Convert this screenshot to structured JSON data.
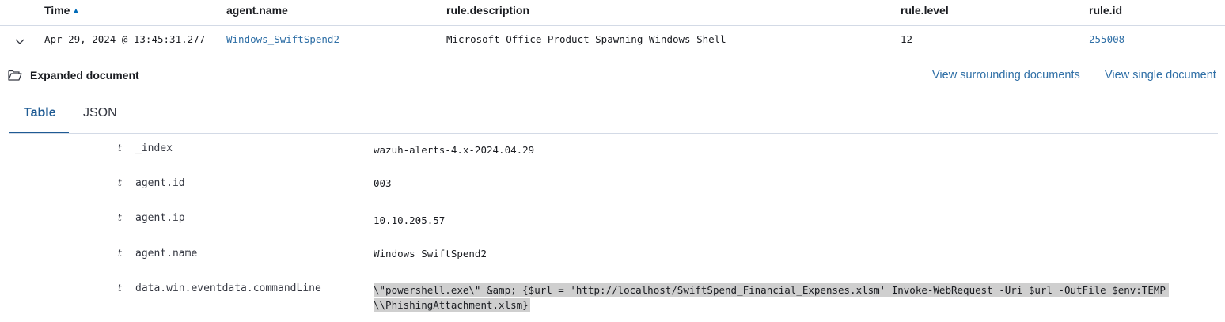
{
  "columns": {
    "time": "Time",
    "agent_name": "agent.name",
    "rule_description": "rule.description",
    "rule_level": "rule.level",
    "rule_id": "rule.id"
  },
  "row": {
    "time": "Apr 29, 2024 @ 13:45:31.277",
    "agent_name": "Windows_SwiftSpend2",
    "rule_description": "Microsoft Office Product Spawning Windows Shell",
    "rule_level": "12",
    "rule_id": "255008"
  },
  "expanded": {
    "title": "Expanded document",
    "view_surrounding": "View surrounding documents",
    "view_single": "View single document",
    "tabs": {
      "table": "Table",
      "json": "JSON"
    }
  },
  "fields": [
    {
      "type": "t",
      "name": "_index",
      "value": "wazuh-alerts-4.x-2024.04.29"
    },
    {
      "type": "t",
      "name": "agent.id",
      "value": "003"
    },
    {
      "type": "t",
      "name": "agent.ip",
      "value": "10.10.205.57"
    },
    {
      "type": "t",
      "name": "agent.name",
      "value": "Windows_SwiftSpend2"
    },
    {
      "type": "t",
      "name": "data.win.eventdata.commandLine",
      "value_line1": "\\\"powershell.exe\\\" &amp; {$url = 'http://localhost/SwiftSpend_Financial_Expenses.xlsm' Invoke-WebRequest -Uri $url -OutFile $env:TEMP",
      "value_line2": "\\\\PhishingAttachment.xlsm}"
    }
  ],
  "colors": {
    "link": "#2f6fa6",
    "accent": "#006bb8",
    "highlight": "#cfcfcf",
    "border": "#d3dae6"
  }
}
